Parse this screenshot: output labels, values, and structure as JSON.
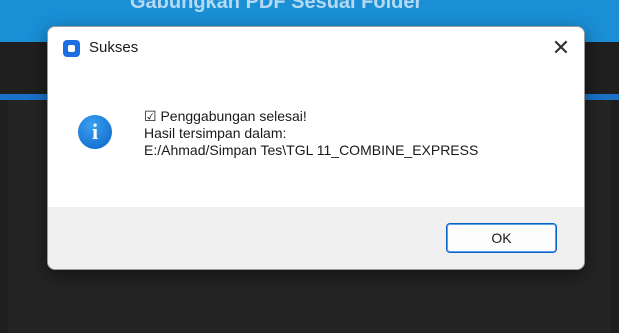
{
  "background_window": {
    "title": "Gabungkan PDF Sesuai Folder"
  },
  "dialog": {
    "title": "Sukses",
    "close_symbol": "✕",
    "info_symbol": "i",
    "message": {
      "line1": "☑ Penggabungan selesai!",
      "line2": "Hasil tersimpan dalam:",
      "line3": "E:/Ahmad/Simpan Tes\\TGL 11_COMBINE_EXPRESS"
    },
    "ok_label": "OK"
  },
  "colors": {
    "accent": "#1a8fd6",
    "info_icon": "#0a64c8"
  },
  "icons": [
    "app-icon",
    "close-icon",
    "info-icon"
  ]
}
